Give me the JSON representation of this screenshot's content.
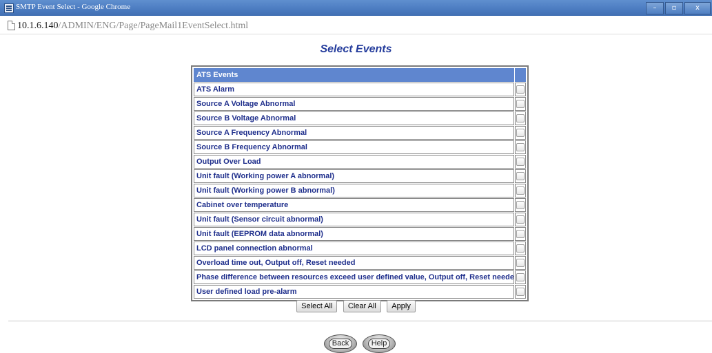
{
  "window": {
    "title": "SMTP Event Select - Google Chrome",
    "controls": {
      "minimize": "–",
      "maximize": "▫",
      "close": "x"
    }
  },
  "address": {
    "host": "10.1.6.140",
    "path": "/ADMIN/ENG/Page/PageMail1EventSelect.html"
  },
  "heading": "Select Events",
  "table": {
    "header": "ATS Events",
    "rows": [
      "ATS Alarm",
      "Source A Voltage Abnormal",
      "Source B Voltage Abnormal",
      "Source A Frequency Abnormal",
      "Source B Frequency Abnormal",
      "Output Over Load",
      "Unit fault (Working power A abnormal)",
      "Unit fault (Working power B abnormal)",
      "Cabinet over temperature",
      "Unit fault (Sensor circuit abnormal)",
      "Unit fault (EEPROM data abnormal)",
      "LCD panel connection abnormal",
      "Overload time out, Output off, Reset needed",
      "Phase difference between resources exceed user defined value, Output off, Reset needed",
      "User defined load pre-alarm"
    ]
  },
  "buttons": {
    "select_all": "Select All",
    "clear_all": "Clear All",
    "apply": "Apply",
    "back": "Back",
    "help": "Help"
  }
}
